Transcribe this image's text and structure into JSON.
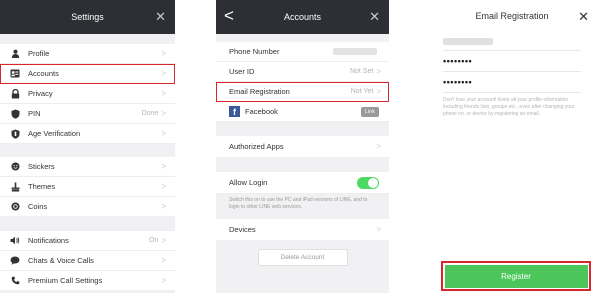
{
  "settings": {
    "title": "Settings",
    "close": "✕",
    "groups": [
      [
        {
          "label": "Profile",
          "value": "",
          "icon": "person-icon"
        },
        {
          "label": "Accounts",
          "value": "",
          "icon": "id-card-icon"
        },
        {
          "label": "Privacy",
          "value": "",
          "icon": "lock-icon"
        },
        {
          "label": "PIN",
          "value": "Done",
          "icon": "shield-icon"
        },
        {
          "label": "Age Verification",
          "value": "",
          "icon": "shield-check-icon"
        }
      ],
      [
        {
          "label": "Stickers",
          "value": "",
          "icon": "smiley-icon"
        },
        {
          "label": "Themes",
          "value": "",
          "icon": "brush-icon"
        },
        {
          "label": "Coins",
          "value": "",
          "icon": "coin-icon"
        }
      ],
      [
        {
          "label": "Notifications",
          "value": "On",
          "icon": "speaker-icon"
        },
        {
          "label": "Chats & Voice Calls",
          "value": "",
          "icon": "chat-bubble-icon"
        },
        {
          "label": "Premium Call Settings",
          "value": "",
          "icon": "phone-icon"
        }
      ]
    ],
    "chevron": ">"
  },
  "accounts": {
    "title": "Accounts",
    "back": "<",
    "close": "✕",
    "phone_label": "Phone Number",
    "user_id_label": "User ID",
    "user_id_value": "Not Set",
    "email_label": "Email Registration",
    "email_value": "Not Yet",
    "facebook_label": "Facebook",
    "facebook_link": "Link",
    "authorized_apps_label": "Authorized Apps",
    "allow_login_label": "Allow Login",
    "allow_login_note": "Switch this on to use the PC and iPad versions of LINE, and to login to other LINE web services.",
    "devices_label": "Devices",
    "delete_account_label": "Delete Account",
    "chevron": ">"
  },
  "email_registration": {
    "title": "Email Registration",
    "close": "✕",
    "password": "••••••••",
    "password_confirm": "••••••••",
    "note": "Don't lose your account! Keep all your profile information including friends lists, groups etc., even after changing your phone no. or device by registering an email.",
    "register_label": "Register"
  },
  "colors": {
    "header_dark": "#2d2f35",
    "highlight_red": "#d9262c",
    "toggle_green": "#4cd964",
    "register_green": "#4cc65b",
    "facebook_blue": "#3b5998"
  }
}
